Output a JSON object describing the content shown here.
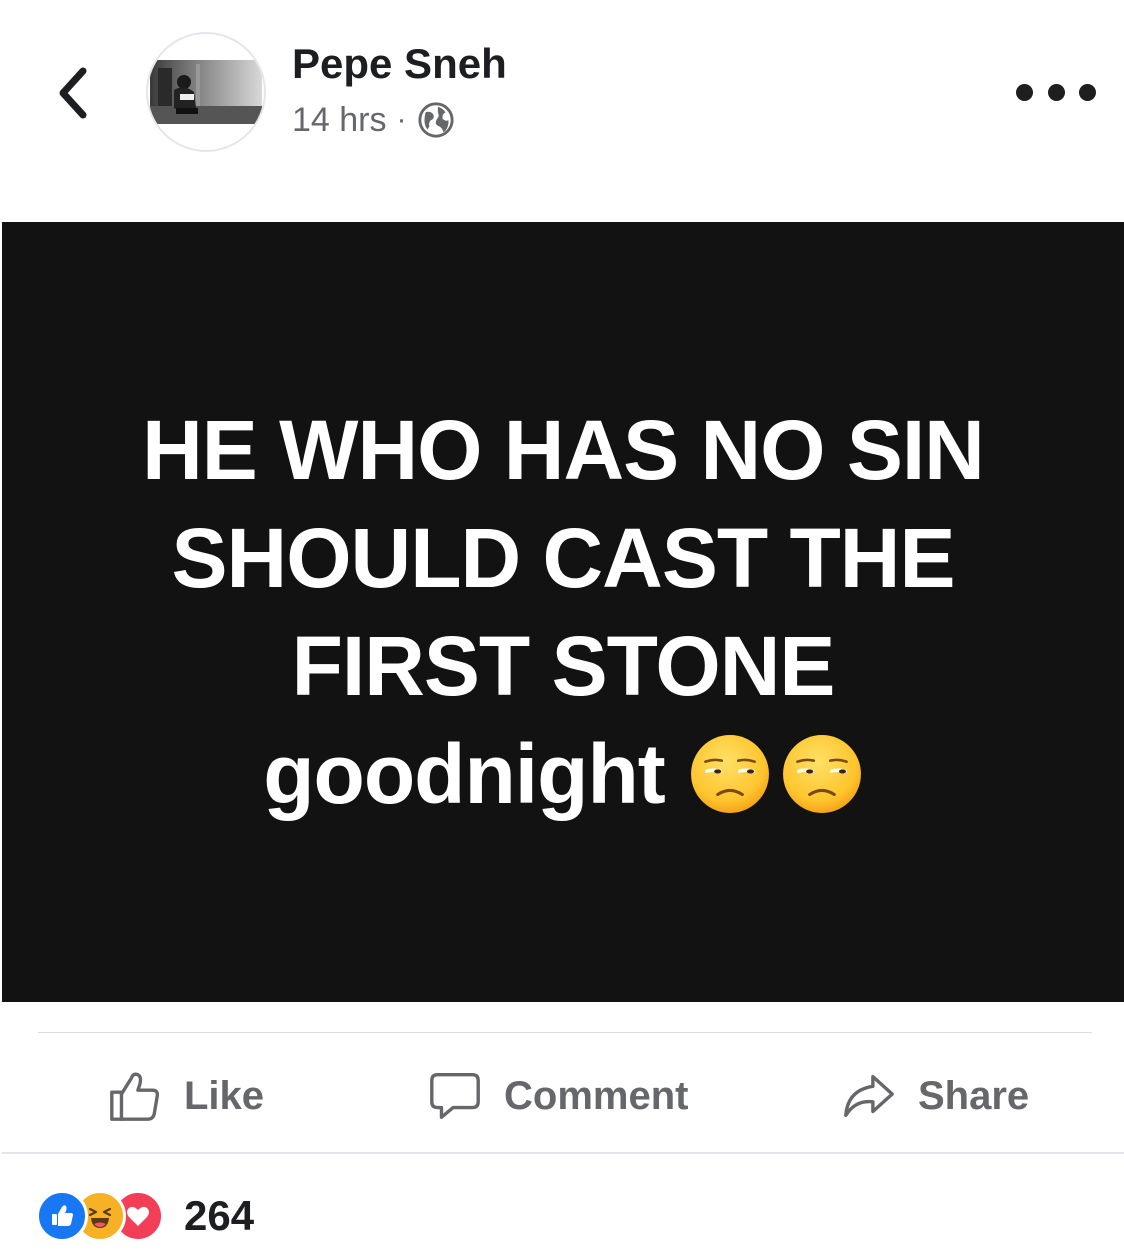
{
  "post": {
    "author_name": "Pepe Sneh",
    "timestamp": "14 hrs",
    "separator": "·",
    "audience_icon": "globe-icon",
    "image_text": {
      "line1": "HE WHO HAS NO SIN",
      "line2": "SHOULD CAST THE",
      "line3": "FIRST STONE",
      "line4": "goodnight",
      "emoji": [
        "unamused-face-emoji",
        "unamused-face-emoji"
      ]
    },
    "image_background": "#121212"
  },
  "actions": {
    "like_label": "Like",
    "comment_label": "Comment",
    "share_label": "Share"
  },
  "reactions": {
    "types": [
      "like-reaction-icon",
      "haha-reaction-icon",
      "love-reaction-icon"
    ],
    "count": "264"
  },
  "colors": {
    "facebook_blue": "#1877f2",
    "haha_yellow": "#f7b125",
    "love_red": "#f33e58",
    "secondary_text": "#65676b"
  }
}
